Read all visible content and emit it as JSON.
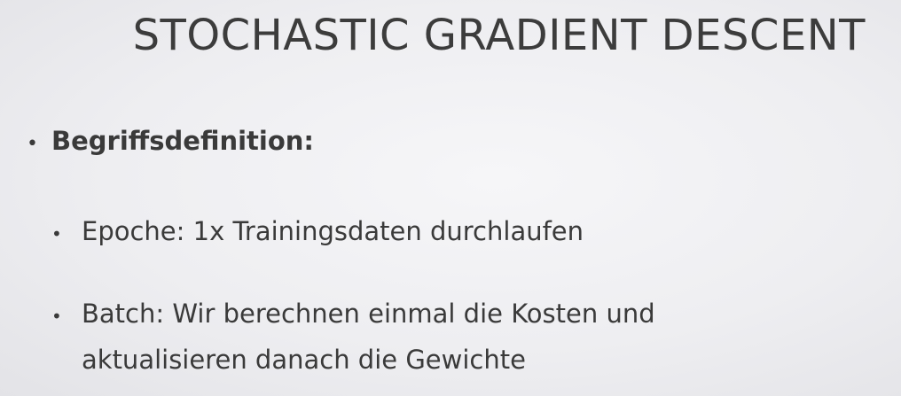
{
  "slide": {
    "title": "STOCHASTIC GRADIENT DESCENT",
    "bullets": [
      {
        "text": "Begriffsdefinition:",
        "children": [
          {
            "text": "Epoche: 1x Trainingsdaten durchlaufen"
          },
          {
            "line1": "Batch: Wir berechnen einmal die Kosten und",
            "line2": "aktualisieren danach die Gewichte"
          }
        ]
      }
    ],
    "bullet_symbol": "•"
  }
}
